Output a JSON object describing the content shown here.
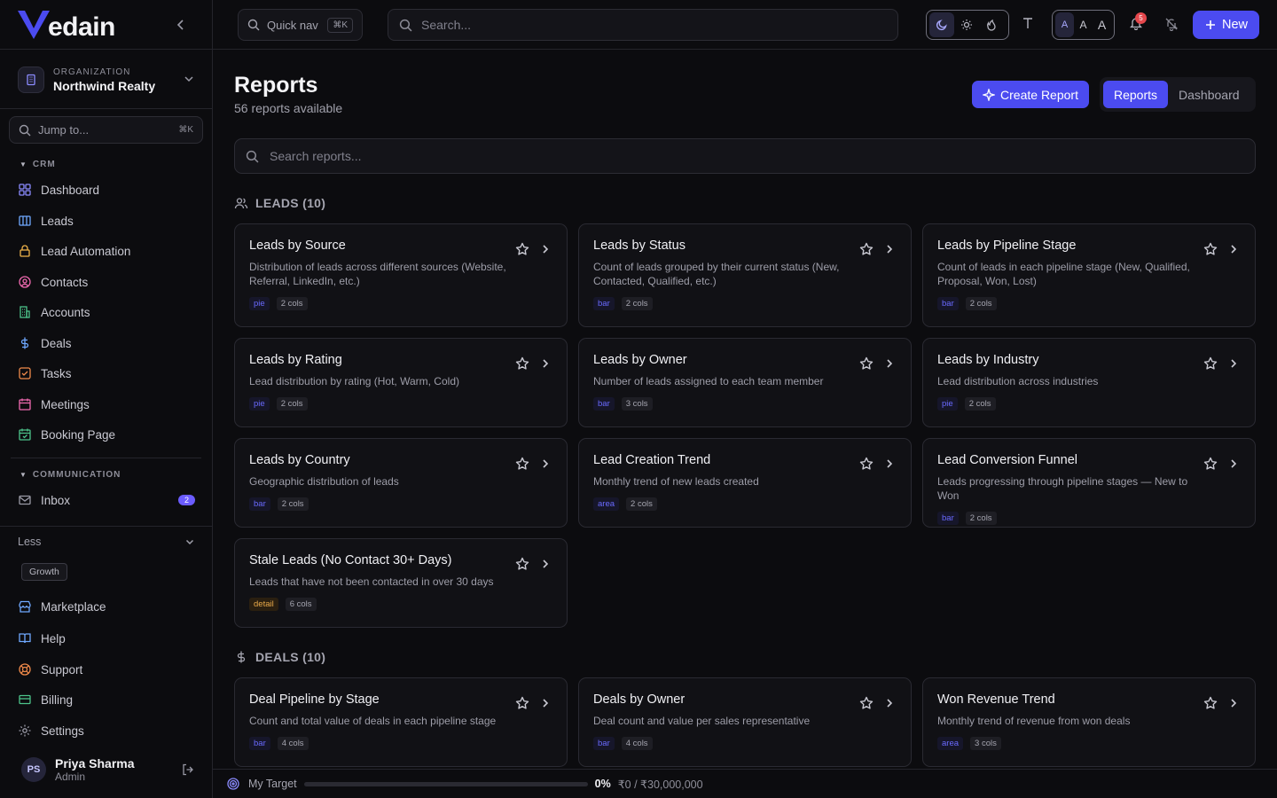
{
  "app": {
    "logo_text": "edain",
    "brand_color": "#4b4bf0"
  },
  "org": {
    "label": "ORGANIZATION",
    "name": "Northwind Realty"
  },
  "jump": {
    "label": "Jump to...",
    "shortcut": "⌘K"
  },
  "sidebar": {
    "crm_label": "CRM",
    "crm_items": [
      {
        "label": "Dashboard",
        "icon": "grid-icon"
      },
      {
        "label": "Leads",
        "icon": "columns-icon"
      },
      {
        "label": "Lead Automation",
        "icon": "lock-icon"
      },
      {
        "label": "Contacts",
        "icon": "user-circle-icon"
      },
      {
        "label": "Accounts",
        "icon": "building-icon"
      },
      {
        "label": "Deals",
        "icon": "dollar-icon"
      },
      {
        "label": "Tasks",
        "icon": "check-square-icon"
      },
      {
        "label": "Meetings",
        "icon": "calendar-icon"
      },
      {
        "label": "Booking Page",
        "icon": "calendar-check-icon"
      }
    ],
    "comm_label": "COMMUNICATION",
    "inbox": {
      "label": "Inbox",
      "badge": "2"
    },
    "less_label": "Less",
    "growth_label": "Growth",
    "bottom_items": [
      {
        "label": "Marketplace",
        "icon": "store-icon"
      },
      {
        "label": "Help",
        "icon": "book-icon"
      },
      {
        "label": "Support",
        "icon": "lifebuoy-icon"
      },
      {
        "label": "Billing",
        "icon": "card-icon"
      },
      {
        "label": "Settings",
        "icon": "gear-icon"
      }
    ]
  },
  "user": {
    "initials": "PS",
    "name": "Priya Sharma",
    "role": "Admin"
  },
  "topbar": {
    "quicknav_label": "Quick nav",
    "quicknav_shortcut": "⌘K",
    "search_placeholder": "Search...",
    "font_sizes": [
      "A",
      "A",
      "A"
    ],
    "notification_count": "5",
    "new_label": "New"
  },
  "page": {
    "title": "Reports",
    "subtitle": "56 reports available",
    "create_label": "Create Report",
    "tabs": [
      "Reports",
      "Dashboard"
    ],
    "search_placeholder": "Search reports..."
  },
  "groups": [
    {
      "title": "LEADS (10)",
      "cards": [
        {
          "title": "Leads by Source",
          "desc": "Distribution of leads across different sources (Website, Referral, LinkedIn, etc.)",
          "type": "pie",
          "cols": "2 cols"
        },
        {
          "title": "Leads by Status",
          "desc": "Count of leads grouped by their current status (New, Contacted, Qualified, etc.)",
          "type": "bar",
          "cols": "2 cols"
        },
        {
          "title": "Leads by Pipeline Stage",
          "desc": "Count of leads in each pipeline stage (New, Qualified, Proposal, Won, Lost)",
          "type": "bar",
          "cols": "2 cols"
        },
        {
          "title": "Leads by Rating",
          "desc": "Lead distribution by rating (Hot, Warm, Cold)",
          "type": "pie",
          "cols": "2 cols"
        },
        {
          "title": "Leads by Owner",
          "desc": "Number of leads assigned to each team member",
          "type": "bar",
          "cols": "3 cols"
        },
        {
          "title": "Leads by Industry",
          "desc": "Lead distribution across industries",
          "type": "pie",
          "cols": "2 cols"
        },
        {
          "title": "Leads by Country",
          "desc": "Geographic distribution of leads",
          "type": "bar",
          "cols": "2 cols"
        },
        {
          "title": "Lead Creation Trend",
          "desc": "Monthly trend of new leads created",
          "type": "area",
          "cols": "2 cols"
        },
        {
          "title": "Lead Conversion Funnel",
          "desc": "Leads progressing through pipeline stages — New to Won",
          "type": "bar",
          "cols": "2 cols"
        },
        {
          "title": "Stale Leads (No Contact 30+ Days)",
          "desc": "Leads that have not been contacted in over 30 days",
          "type": "detail",
          "cols": "6 cols"
        }
      ]
    },
    {
      "title": "DEALS (10)",
      "cards": [
        {
          "title": "Deal Pipeline by Stage",
          "desc": "Count and total value of deals in each pipeline stage",
          "type": "bar",
          "cols": "4 cols"
        },
        {
          "title": "Deals by Owner",
          "desc": "Deal count and value per sales representative",
          "type": "bar",
          "cols": "4 cols"
        },
        {
          "title": "Won Revenue Trend",
          "desc": "Monthly trend of revenue from won deals",
          "type": "area",
          "cols": "3 cols"
        }
      ]
    }
  ],
  "target": {
    "label": "My Target",
    "percent": "0%",
    "progress": 0,
    "amount": "₹0 / ₹30,000,000"
  }
}
